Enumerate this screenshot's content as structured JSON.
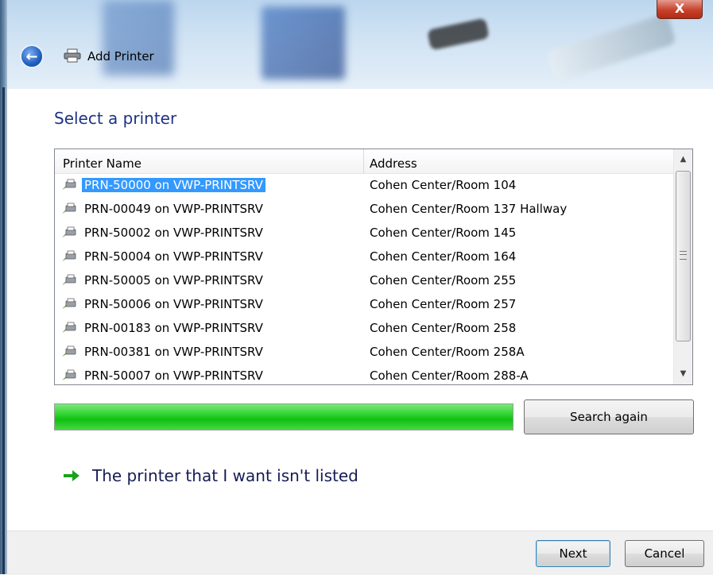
{
  "window": {
    "title": "Add Printer",
    "close_label": "X"
  },
  "page": {
    "heading": "Select a printer"
  },
  "table": {
    "columns": [
      "Printer Name",
      "Address"
    ],
    "rows": [
      {
        "name": "PRN-50000 on VWP-PRINTSRV",
        "address": "Cohen Center/Room 104",
        "selected": true
      },
      {
        "name": "PRN-00049 on VWP-PRINTSRV",
        "address": "Cohen Center/Room 137 Hallway",
        "selected": false
      },
      {
        "name": "PRN-50002 on VWP-PRINTSRV",
        "address": "Cohen Center/Room 145",
        "selected": false
      },
      {
        "name": "PRN-50004 on VWP-PRINTSRV",
        "address": "Cohen Center/Room 164",
        "selected": false
      },
      {
        "name": "PRN-50005 on VWP-PRINTSRV",
        "address": "Cohen Center/Room 255",
        "selected": false
      },
      {
        "name": "PRN-50006 on VWP-PRINTSRV",
        "address": "Cohen Center/Room 257",
        "selected": false
      },
      {
        "name": "PRN-00183 on VWP-PRINTSRV",
        "address": "Cohen Center/Room 258",
        "selected": false
      },
      {
        "name": "PRN-00381 on VWP-PRINTSRV",
        "address": "Cohen Center/Room 258A",
        "selected": false
      },
      {
        "name": "PRN-50007 on VWP-PRINTSRV",
        "address": "Cohen Center/Room 288-A",
        "selected": false
      }
    ]
  },
  "progress": {
    "fraction": 1.0,
    "color": "#22cc22"
  },
  "buttons": {
    "search_again": "Search again",
    "next": "Next",
    "cancel": "Cancel"
  },
  "link": {
    "text": "The printer that I want isn't listed",
    "icon": "green-arrow-icon"
  },
  "colors": {
    "heading": "#1e3287",
    "selection": "#3399ff",
    "link": "#151c55"
  }
}
